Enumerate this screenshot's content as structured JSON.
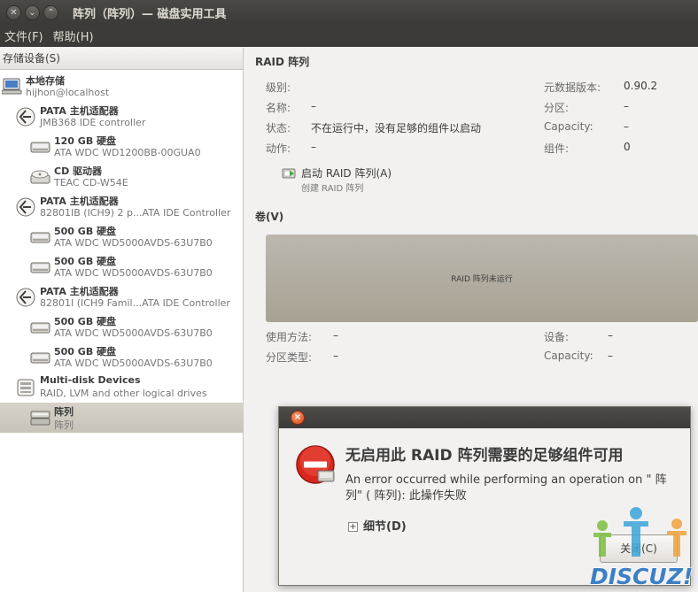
{
  "window": {
    "title": "阵列（阵列）— 磁盘实用工具"
  },
  "menu": {
    "file": "文件(F)",
    "help": "帮助(H)"
  },
  "sidebar": {
    "header": "存储设备(S)",
    "items": [
      {
        "icon": "computer-icon",
        "title": "本地存储",
        "subtitle": "hijhon@localhost",
        "indent": 0
      },
      {
        "icon": "controller-icon",
        "title": "PATA 主机适配器",
        "subtitle": "JMB368 IDE controller",
        "indent": 1
      },
      {
        "icon": "hard-disk-icon",
        "title": "120 GB 硬盘",
        "subtitle": "ATA WDC WD1200BB-00GUA0",
        "indent": 2
      },
      {
        "icon": "cd-drive-icon",
        "title": "CD 驱动器",
        "subtitle": "TEAC CD-W54E",
        "indent": 2
      },
      {
        "icon": "controller-icon",
        "title": "PATA 主机适配器",
        "subtitle": "82801IB (ICH9) 2 p...ATA IDE Controller",
        "indent": 1
      },
      {
        "icon": "hard-disk-icon",
        "title": "500 GB 硬盘",
        "subtitle": "ATA WDC WD5000AVDS-63U7B0",
        "indent": 2
      },
      {
        "icon": "hard-disk-icon",
        "title": "500 GB 硬盘",
        "subtitle": "ATA WDC WD5000AVDS-63U7B0",
        "indent": 2
      },
      {
        "icon": "controller-icon",
        "title": "PATA 主机适配器",
        "subtitle": "82801I (ICH9 Famil...ATA IDE Controller",
        "indent": 1
      },
      {
        "icon": "hard-disk-icon",
        "title": "500 GB 硬盘",
        "subtitle": "ATA WDC WD5000AVDS-63U7B0",
        "indent": 2
      },
      {
        "icon": "hard-disk-icon",
        "title": "500 GB 硬盘",
        "subtitle": "ATA WDC WD5000AVDS-63U7B0",
        "indent": 2
      },
      {
        "icon": "multi-disk-icon",
        "title": "Multi-disk Devices",
        "subtitle": "RAID, LVM and other logical drives",
        "indent": 1
      },
      {
        "icon": "raid-array-icon",
        "title": "阵列",
        "subtitle": "阵列",
        "indent": 2,
        "selected": true
      }
    ]
  },
  "raid": {
    "title": "RAID 阵列",
    "left_fields": [
      {
        "label": "级别:",
        "value": ""
      },
      {
        "label": "名称:",
        "value": "–"
      },
      {
        "label": "状态:",
        "value": "不在运行中，没有足够的组件以启动"
      },
      {
        "label": "动作:",
        "value": "–"
      }
    ],
    "right_fields": [
      {
        "label": "元数据版本:",
        "value": "0.90.2"
      },
      {
        "label": "分区:",
        "value": "–"
      },
      {
        "label": "Capacity:",
        "value": "–"
      },
      {
        "label": "组件:",
        "value": "0"
      }
    ],
    "action_label": "启动 RAID 阵列(A)",
    "action_sub": "创建 RAID 阵列"
  },
  "volumes": {
    "title": "卷(V)",
    "bar_text": "RAID 阵列未运行",
    "left_fields": [
      {
        "label": "使用方法:",
        "value": "–"
      },
      {
        "label": "分区类型:",
        "value": "–"
      }
    ],
    "right_fields": [
      {
        "label": "设备:",
        "value": "–"
      },
      {
        "label": "Capacity:",
        "value": "–"
      }
    ]
  },
  "dialog": {
    "heading": "无启用此 RAID 阵列需要的足够组件可用",
    "message": "An error occurred while performing an operation on \" 阵列\" ( 阵列): 此操作失败",
    "details": "细节(D)",
    "close_button": "关闭(C)"
  },
  "watermark": {
    "text": "DISCUZ!"
  }
}
